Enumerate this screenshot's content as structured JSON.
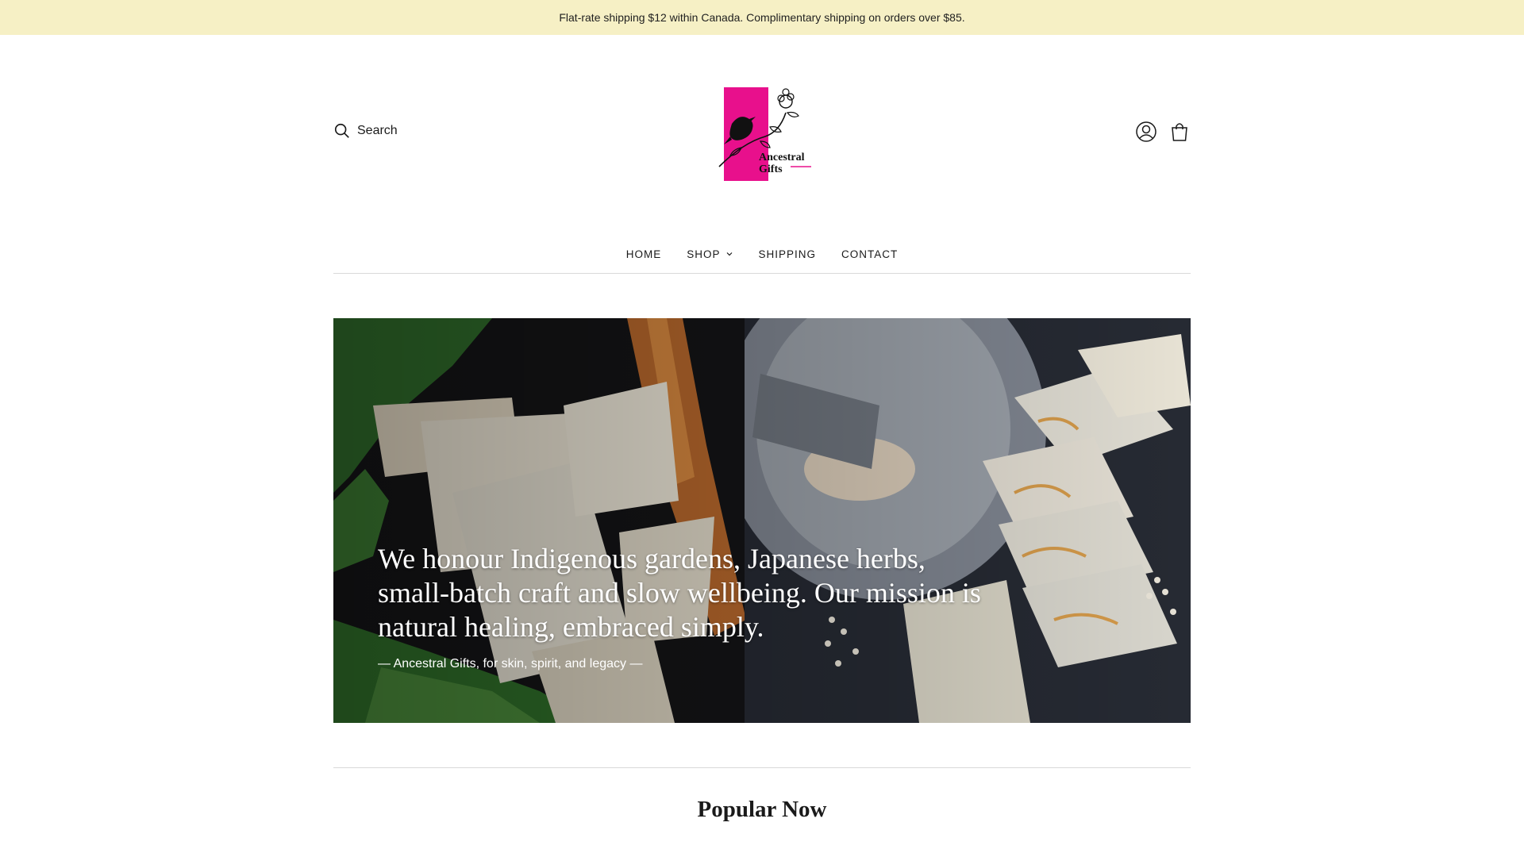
{
  "announcement": {
    "text": "Flat-rate shipping $12 within Canada. Complimentary shipping on orders over $85."
  },
  "header": {
    "search_label": "Search",
    "logo": {
      "text_line1": "Ancestral",
      "text_line2": "Gifts",
      "accent_color": "#e8108c"
    },
    "icons": [
      "account-icon",
      "cart-icon"
    ]
  },
  "nav": {
    "items": [
      {
        "label": "HOME",
        "has_dropdown": false
      },
      {
        "label": "SHOP",
        "has_dropdown": true
      },
      {
        "label": "SHIPPING",
        "has_dropdown": false
      },
      {
        "label": "CONTACT",
        "has_dropdown": false
      }
    ]
  },
  "hero": {
    "quote": "We honour Indigenous gardens, Japanese herbs, small-batch craft and slow wellbeing. Our mission is natural healing, embraced simply.",
    "attribution": "— Ancestral Gifts, for skin, spirit, and legacy —"
  },
  "popular": {
    "title": "Popular Now"
  },
  "colors": {
    "announcement_bg": "#f6f0c5",
    "brand_pink": "#e8108c",
    "divider": "#d9d9d9"
  }
}
